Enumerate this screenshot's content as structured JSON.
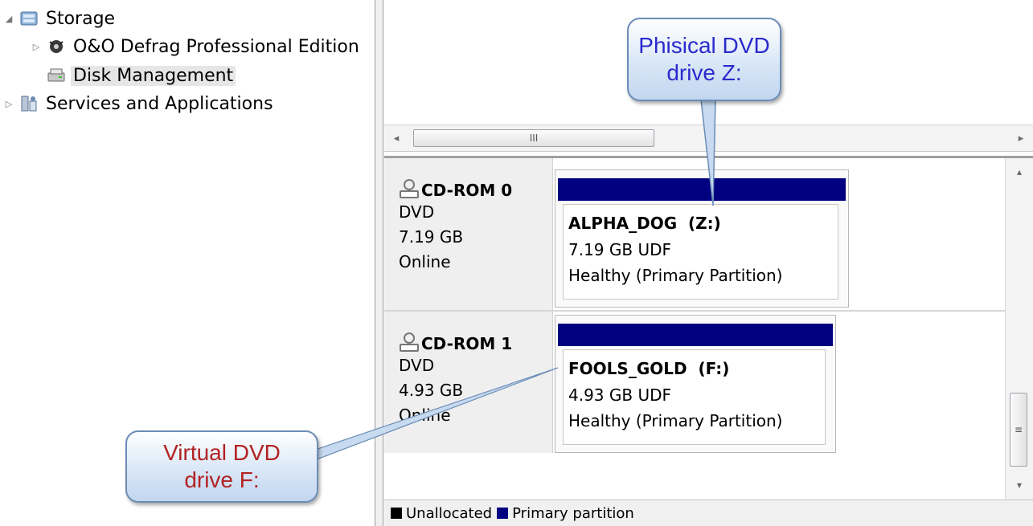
{
  "tree": {
    "items": [
      {
        "label": "Storage",
        "toggle": "◢",
        "icon": "storage-icon"
      },
      {
        "label": "O&O Defrag Professional Edition",
        "toggle": "▷",
        "icon": "defrag-icon"
      },
      {
        "label": "Disk Management",
        "toggle": "",
        "icon": "disk-management-icon"
      },
      {
        "label": "Services and Applications",
        "toggle": "▷",
        "icon": "services-icon"
      }
    ]
  },
  "hscroll": {
    "left_arrow": "◂",
    "right_arrow": "▸",
    "grip": "III"
  },
  "vscroll": {
    "up_arrow": "▴",
    "down_arrow": "▾",
    "grip": "≡"
  },
  "disks": [
    {
      "name": "CD-ROM 0",
      "type": "DVD",
      "size": "7.19 GB",
      "status": "Online",
      "partition": {
        "name": "ALPHA_DOG  (Z:)",
        "size": "7.19 GB UDF",
        "status": "Healthy (Primary Partition)"
      }
    },
    {
      "name": "CD-ROM 1",
      "type": "DVD",
      "size": "4.93 GB",
      "status": "Online",
      "partition": {
        "name": "FOOLS_GOLD  (F:)",
        "size": "4.93 GB UDF",
        "status": "Healthy (Primary Partition)"
      }
    }
  ],
  "legend": {
    "unallocated": {
      "label": "Unallocated",
      "color": "#000000"
    },
    "primary": {
      "label": "Primary partition",
      "color": "#000080"
    }
  },
  "callouts": {
    "physical": {
      "line1": "Phisical DVD",
      "line2": "drive Z:",
      "color": "#2a2acc"
    },
    "virtual": {
      "line1": "Virtual DVD",
      "line2": "drive F:",
      "color": "#b22222"
    }
  }
}
